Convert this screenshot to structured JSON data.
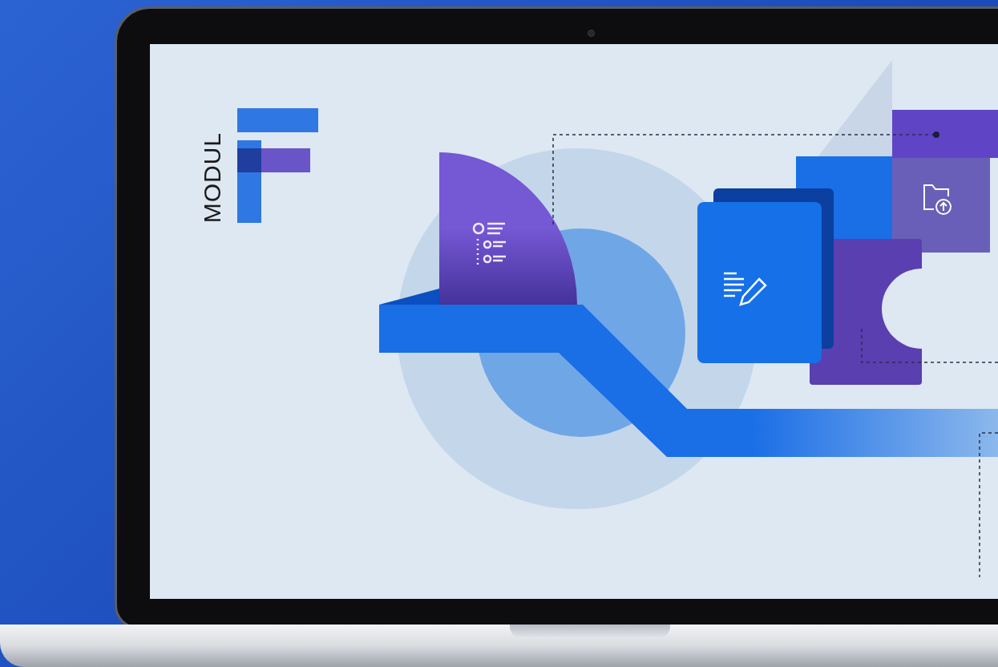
{
  "logo": {
    "text": "MODUL"
  }
}
